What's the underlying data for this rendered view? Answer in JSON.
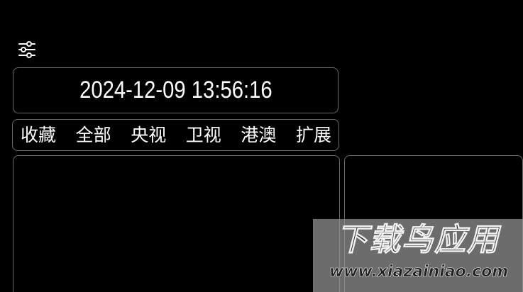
{
  "header": {
    "settings_icon": "sliders-icon"
  },
  "clock": {
    "datetime": "2024-12-09 13:56:16"
  },
  "tabs": [
    {
      "label": "收藏"
    },
    {
      "label": "全部"
    },
    {
      "label": "央视"
    },
    {
      "label": "卫视"
    },
    {
      "label": "港澳"
    },
    {
      "label": "扩展"
    }
  ],
  "watermark": {
    "title": "下载鸟应用",
    "url": "www.xiazainiao.com"
  },
  "colors": {
    "background": "#000000",
    "text": "#ffffff",
    "border": "#6a6a6a"
  }
}
